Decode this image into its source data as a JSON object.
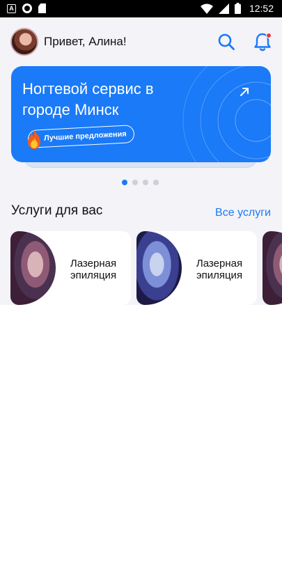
{
  "status_bar": {
    "notification_icon_letter": "A",
    "time": "12:52"
  },
  "header": {
    "greeting": "Привет, Алина!",
    "icons": [
      "avatar",
      "search-icon",
      "bell-icon"
    ]
  },
  "banner": {
    "title": "Ногтевой сервис в городе Минск",
    "chip_label": "Лучшие предложения",
    "accent_color": "#1a7af8"
  },
  "carousel": {
    "page_count": 4,
    "active_index": 0
  },
  "services": {
    "title": "Услуги для вас",
    "all_link": "Все услуги",
    "items": [
      {
        "label": "Лазерная эпиляция"
      },
      {
        "label": "Лазерная эпиляция"
      },
      {
        "label": ""
      }
    ]
  }
}
